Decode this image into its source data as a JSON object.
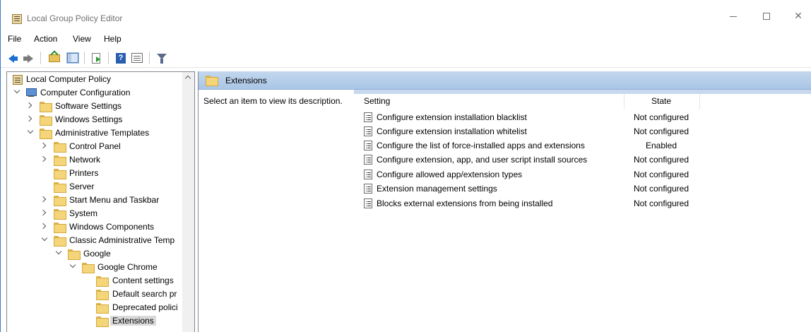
{
  "window": {
    "title": "Local Group Policy Editor",
    "controls": {
      "minimize": "—",
      "maximize": "☐",
      "close": "✕"
    }
  },
  "menu": [
    "File",
    "Action",
    "View",
    "Help"
  ],
  "toolbar": {
    "icons": [
      "back-arrow-icon",
      "forward-arrow-icon",
      "up-folder-icon",
      "show-hide-tree-icon",
      "export-list-icon",
      "help-icon",
      "properties-icon",
      "filter-icon"
    ],
    "help_glyph": "?"
  },
  "tree": {
    "items": [
      {
        "label": "Local Computer Policy",
        "icon": "policy-icon",
        "expander": "none",
        "level": 0
      },
      {
        "label": "Computer Configuration",
        "icon": "computer-icon",
        "expander": "down",
        "level": 0
      },
      {
        "label": "Software Settings",
        "icon": "folder-icon",
        "expander": "right",
        "level": 1
      },
      {
        "label": "Windows Settings",
        "icon": "folder-icon",
        "expander": "right",
        "level": 1
      },
      {
        "label": "Administrative Templates",
        "icon": "folder-icon",
        "expander": "down",
        "level": 1
      },
      {
        "label": "Control Panel",
        "icon": "folder-icon",
        "expander": "right",
        "level": 2
      },
      {
        "label": "Network",
        "icon": "folder-icon",
        "expander": "right",
        "level": 2
      },
      {
        "label": "Printers",
        "icon": "folder-icon",
        "expander": "none",
        "level": 2
      },
      {
        "label": "Server",
        "icon": "folder-icon",
        "expander": "none",
        "level": 2
      },
      {
        "label": "Start Menu and Taskbar",
        "icon": "folder-icon",
        "expander": "right",
        "level": 2
      },
      {
        "label": "System",
        "icon": "folder-icon",
        "expander": "right",
        "level": 2
      },
      {
        "label": "Windows Components",
        "icon": "folder-icon",
        "expander": "right",
        "level": 2
      },
      {
        "label": "Classic Administrative Temp",
        "icon": "folder-icon",
        "expander": "down",
        "level": 2
      },
      {
        "label": "Google",
        "icon": "folder-icon",
        "expander": "down",
        "level": 3
      },
      {
        "label": "Google Chrome",
        "icon": "folder-icon",
        "expander": "down",
        "level": 4
      },
      {
        "label": "Content settings",
        "icon": "folder-icon",
        "expander": "none",
        "level": 5
      },
      {
        "label": "Default search pr",
        "icon": "folder-icon",
        "expander": "none",
        "level": 5
      },
      {
        "label": "Deprecated polici",
        "icon": "folder-icon",
        "expander": "none",
        "level": 5
      },
      {
        "label": "Extensions",
        "icon": "folder-icon",
        "expander": "none",
        "level": 5,
        "selected": true
      }
    ]
  },
  "right_pane": {
    "header_title": "Extensions",
    "description": "Select an item to view its description.",
    "columns": {
      "setting": "Setting",
      "state": "State"
    },
    "rows": [
      {
        "setting": "Configure extension installation blacklist",
        "state": "Not configured"
      },
      {
        "setting": "Configure extension installation whitelist",
        "state": "Not configured"
      },
      {
        "setting": "Configure the list of force-installed apps and extensions",
        "state": "Enabled"
      },
      {
        "setting": "Configure extension, app, and user script install sources",
        "state": "Not configured"
      },
      {
        "setting": "Configure allowed app/extension types",
        "state": "Not configured"
      },
      {
        "setting": "Extension management settings",
        "state": "Not configured"
      },
      {
        "setting": "Blocks external extensions from being installed",
        "state": "Not configured"
      }
    ]
  },
  "colors": {
    "header_gradient_top": "#c3d7ee",
    "header_gradient_bottom": "#aac6e6",
    "selection": "#d9d9d9",
    "folder": "#f5d57a"
  }
}
